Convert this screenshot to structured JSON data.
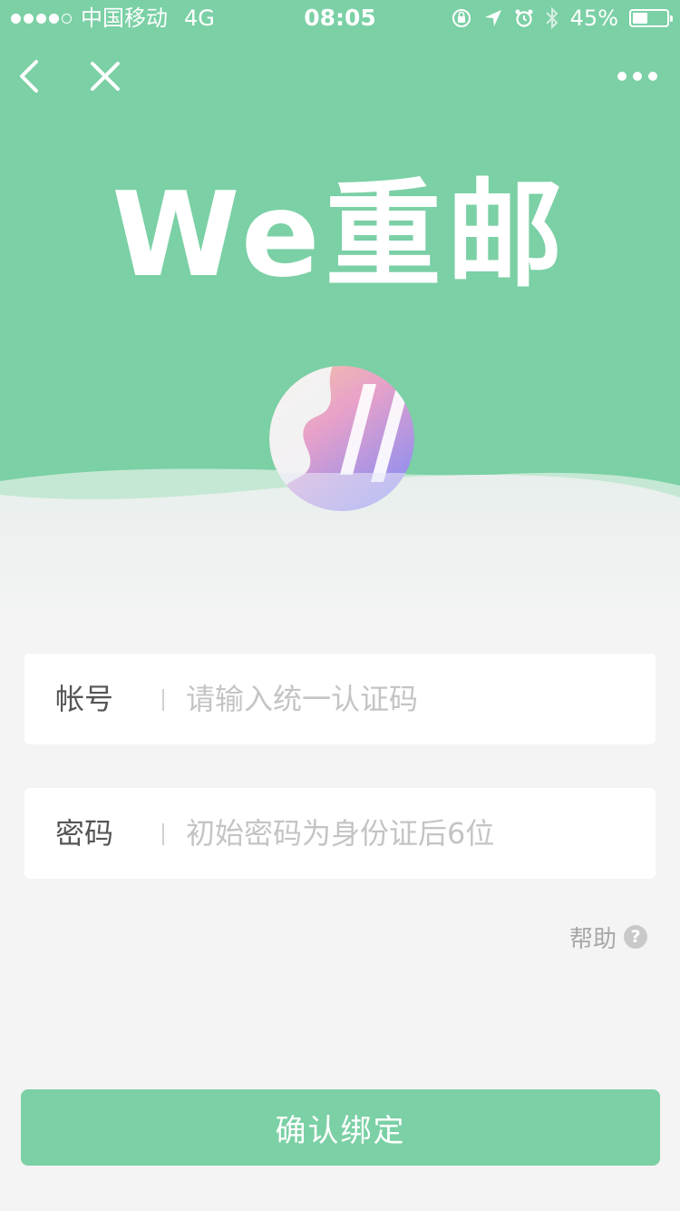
{
  "status_bar": {
    "carrier": "中国移动",
    "network": "4G",
    "time": "08:05",
    "battery": "45%",
    "battery_level": 0.45,
    "icons": [
      "orientation-lock-icon",
      "location-arrow-icon",
      "alarm-icon",
      "bluetooth-icon",
      "battery-icon"
    ]
  },
  "nav": {
    "back_icon": "chevron-left-icon",
    "close_icon": "close-icon",
    "more_icon": "more-dots-icon"
  },
  "header": {
    "logo_text": "We重邮"
  },
  "form": {
    "account": {
      "label": "帐号",
      "value": "",
      "placeholder": "请输入统一认证码"
    },
    "password": {
      "label": "密码",
      "value": "",
      "placeholder": "初始密码为身份证后6位"
    }
  },
  "help": {
    "label": "帮助",
    "icon": "question-circle-icon",
    "icon_glyph": "?"
  },
  "submit": {
    "label": "确认绑定"
  },
  "colors": {
    "accent": "#7bd0a5",
    "background": "#f4f4f4",
    "placeholder": "#c4c4c4"
  }
}
